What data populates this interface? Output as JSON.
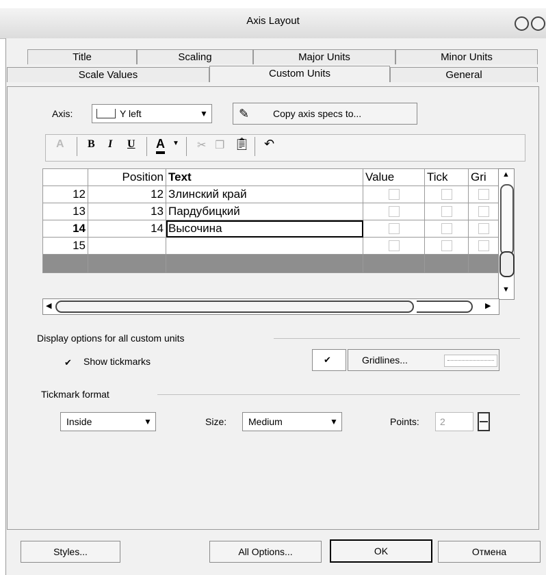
{
  "window": {
    "title": "Axis Layout"
  },
  "tabs_row1": [
    "Title",
    "Scaling",
    "Major Units",
    "Minor Units"
  ],
  "tabs_row2": [
    "Scale Values",
    "Custom Units",
    "General"
  ],
  "axis": {
    "label": "Axis:",
    "value": "Y left"
  },
  "copy_button": "Copy axis specs to...",
  "toolbar": {
    "bold": "B",
    "italic": "I",
    "underline": "U",
    "color": "A",
    "undo": "↶",
    "font": "A"
  },
  "grid": {
    "headers": [
      "Position",
      "Text",
      "Value",
      "Tick",
      "Gri"
    ],
    "rows": [
      {
        "num": "12",
        "position": "12",
        "text": "Злинский край"
      },
      {
        "num": "13",
        "position": "13",
        "text": "Пардубицкий"
      },
      {
        "num": "14",
        "position": "14",
        "text": "Высочина"
      },
      {
        "num": "15",
        "position": "",
        "text": ""
      }
    ]
  },
  "display_group": {
    "title": "Display options for all custom units",
    "show_tickmarks": "Show tickmarks",
    "gridlines_button": "Gridlines..."
  },
  "tickmark_group": {
    "title": "Tickmark format",
    "placement": "Inside",
    "size_label": "Size:",
    "size_value": "Medium",
    "points_label": "Points:",
    "points_value": "2"
  },
  "buttons": {
    "styles": "Styles...",
    "all_options": "All Options...",
    "ok": "OK",
    "cancel": "Отмена"
  }
}
